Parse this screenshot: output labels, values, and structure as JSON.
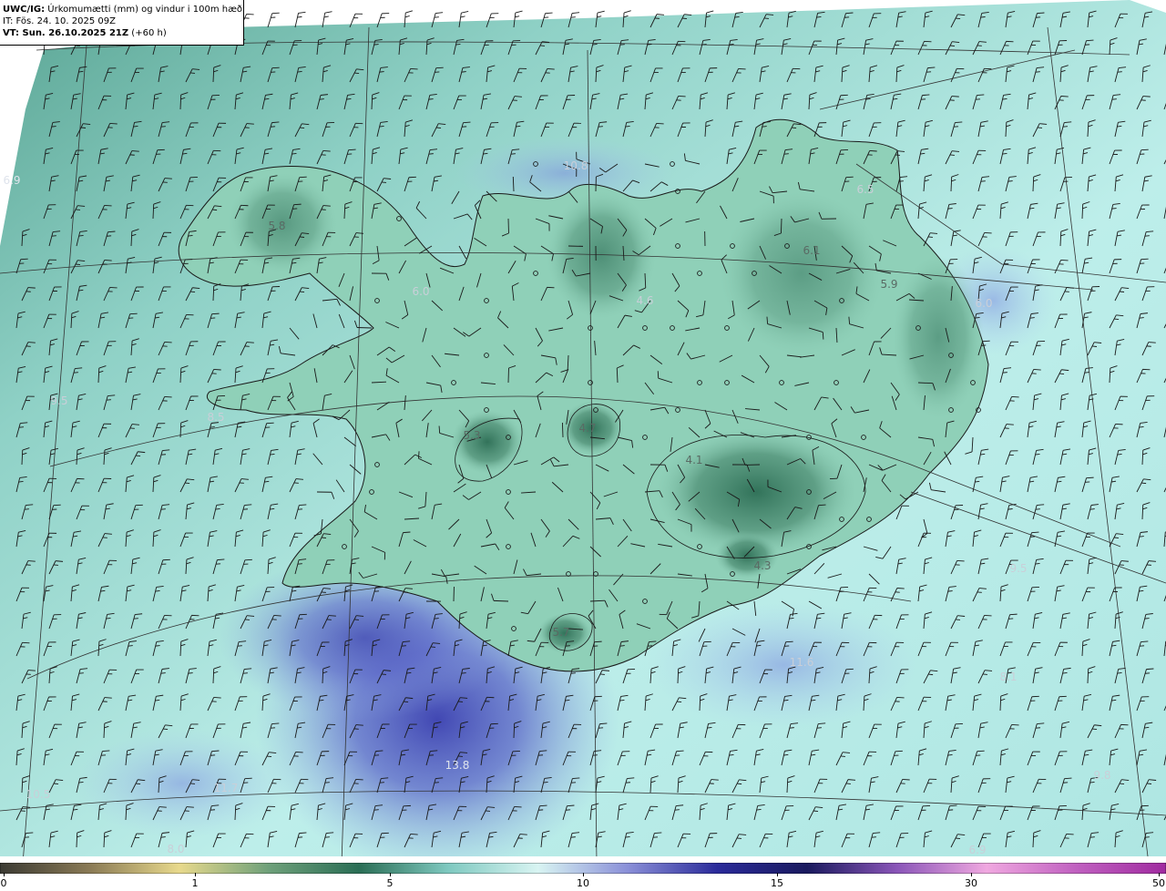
{
  "header": {
    "line1_bold": "UWC/IG:",
    "line1_rest": " Úrkomumætti (mm) og vindur i 100m hæð",
    "line2": "IT: Fös. 24. 10. 2025 09Z",
    "line3_bold": "VT: Sun. 26.10.2025 21Z",
    "line3_rest": " (+60 h)"
  },
  "map_values": [
    {
      "id": "v1",
      "text": "6.9",
      "tone": "light"
    },
    {
      "id": "v2",
      "text": "5.8",
      "tone": "dark"
    },
    {
      "id": "v3",
      "text": "6.0",
      "tone": "faint"
    },
    {
      "id": "v4",
      "text": "10.8",
      "tone": "faint"
    },
    {
      "id": "v5",
      "text": "6.5",
      "tone": "faint"
    },
    {
      "id": "v6",
      "text": "6.1",
      "tone": "dark"
    },
    {
      "id": "v7",
      "text": "5.9",
      "tone": "dark"
    },
    {
      "id": "v8",
      "text": "6.0",
      "tone": "faint"
    },
    {
      "id": "v9",
      "text": "4.6",
      "tone": "faint"
    },
    {
      "id": "v10",
      "text": "4.7",
      "tone": "dark"
    },
    {
      "id": "v11",
      "text": "5.3",
      "tone": "dark"
    },
    {
      "id": "v12",
      "text": "4.1",
      "tone": "dark"
    },
    {
      "id": "v13",
      "text": "4.3",
      "tone": "dark"
    },
    {
      "id": "v14",
      "text": "5.7",
      "tone": "dark"
    },
    {
      "id": "v15",
      "text": "11.6",
      "tone": "faint"
    },
    {
      "id": "v16",
      "text": "9.5",
      "tone": "faint"
    },
    {
      "id": "v17",
      "text": "8.1",
      "tone": "faint"
    },
    {
      "id": "v18",
      "text": "13.8",
      "tone": "light"
    },
    {
      "id": "v19",
      "text": "10.5",
      "tone": "faint"
    },
    {
      "id": "v20",
      "text": "11.7",
      "tone": "faint"
    },
    {
      "id": "v21",
      "text": "9.8",
      "tone": "faint"
    },
    {
      "id": "v22",
      "text": "8.0",
      "tone": "faint"
    },
    {
      "id": "v23",
      "text": "6.9",
      "tone": "faint"
    },
    {
      "id": "v24",
      "text": "8.5",
      "tone": "faint"
    },
    {
      "id": "v25",
      "text": "9.5",
      "tone": "faint"
    }
  ],
  "colorbar": {
    "ticks": [
      "0",
      "1",
      "5",
      "10",
      "15",
      "30",
      "50"
    ],
    "colors": [
      "#3b3a33",
      "#8a7a55",
      "#e8d98c",
      "#6ea07a",
      "#2a6e55",
      "#7fc9c0",
      "#d8f4f2",
      "#8a8fd8",
      "#2a2a9a",
      "#1a1a5e",
      "#8a55b8",
      "#f0a8e0",
      "#c060c0",
      "#a02aa0"
    ]
  }
}
